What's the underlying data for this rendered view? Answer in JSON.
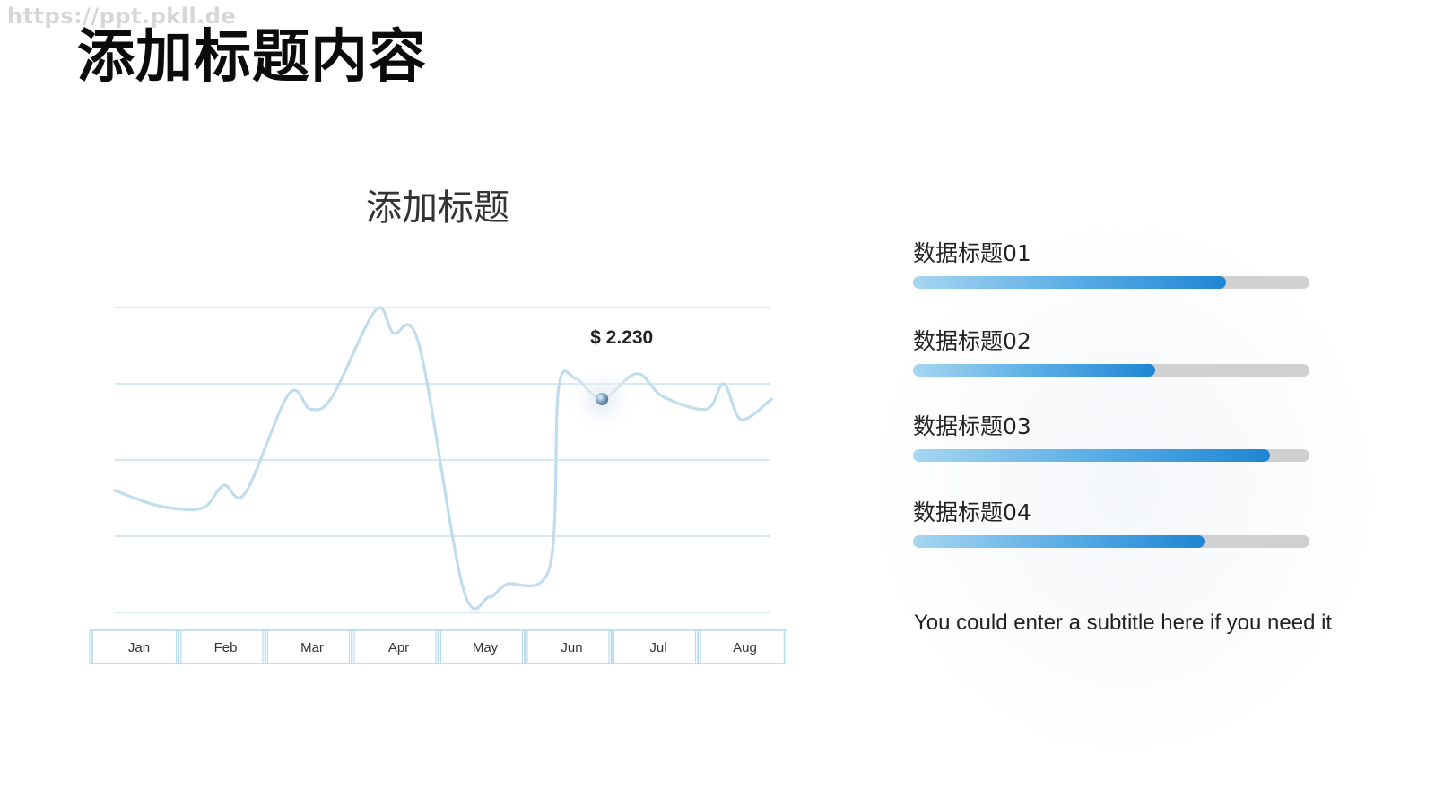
{
  "watermark": "https://ppt.pkll.de",
  "page_title": "添加标题内容",
  "chart_data": {
    "type": "line",
    "title": "添加标题",
    "categories": [
      "Jan",
      "Feb",
      "Mar",
      "Apr",
      "May",
      "Jun",
      "Jul",
      "Aug"
    ],
    "x": [
      0,
      0.5,
      1,
      1.25,
      1.5,
      2,
      2.25,
      2.5,
      3,
      3.2,
      3.5,
      4,
      4.3,
      4.5,
      5,
      5.1,
      5.3,
      5.6,
      6,
      6.3,
      6.8,
      7,
      7.2,
      7.55
    ],
    "values": [
      0.4,
      0.1,
      0.05,
      0.5,
      0.35,
      2.3,
      2.0,
      2.25,
      3.95,
      3.5,
      3.25,
      -1.5,
      -1.7,
      -1.45,
      -1.1,
      2.4,
      2.6,
      2.2,
      2.7,
      2.25,
      2.0,
      2.5,
      1.8,
      2.2
    ],
    "ylim": [
      -2,
      4
    ],
    "grid": true,
    "annotation": {
      "label": "$ 2.230",
      "x": 5.6,
      "y": 2.2
    }
  },
  "bars": [
    {
      "label": "数据标题01",
      "value": 0.79
    },
    {
      "label": "数据标题02",
      "value": 0.61
    },
    {
      "label": "数据标题03",
      "value": 0.9
    },
    {
      "label": "数据标题04",
      "value": 0.735
    }
  ],
  "subtitle": "You could enter a subtitle here if you need it",
  "colors": {
    "line": "#bfdded",
    "grid": "#c6dff0",
    "box": "#b7dbee",
    "marker": "#7aa0c0",
    "bar_track": "#cfd0d2",
    "bar_fill_start": "#a6d6f1",
    "bar_fill_end": "#1f86d3"
  }
}
